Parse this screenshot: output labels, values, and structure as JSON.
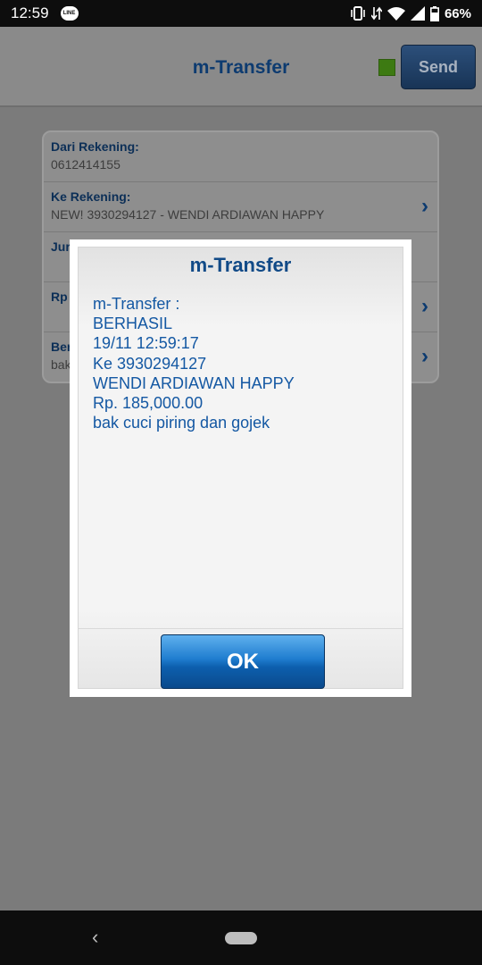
{
  "status": {
    "time": "12:59",
    "battery": "66%",
    "icons": [
      "line-icon",
      "vibrate-icon",
      "data-icon",
      "wifi-icon",
      "signal-icon",
      "battery-icon"
    ]
  },
  "header": {
    "title": "m-Transfer",
    "send_label": "Send",
    "indicator_color": "#3d7a12"
  },
  "form": {
    "from": {
      "label": "Dari Rekening:",
      "value": "0612414155"
    },
    "to": {
      "label": "Ke Rekening:",
      "value": "NEW! 3930294127 - WENDI ARDIAWAN HAPPY"
    },
    "amount_label_partial": "Jur",
    "currency_partial": "Rp",
    "note_label_partial": "Ber",
    "note_value_partial": "bak"
  },
  "dialog": {
    "title": "m-Transfer",
    "message_lines": [
      "m-Transfer :",
      "BERHASIL",
      "19/11 12:59:17",
      "Ke 3930294127",
      "WENDI ARDIAWAN HAPPY",
      "Rp. 185,000.00",
      "bak cuci piring dan gojek"
    ],
    "ok_label": "OK"
  },
  "colors": {
    "accent": "#114a87",
    "message_text": "#1458a3",
    "ok_button": "#1f7dcf"
  }
}
